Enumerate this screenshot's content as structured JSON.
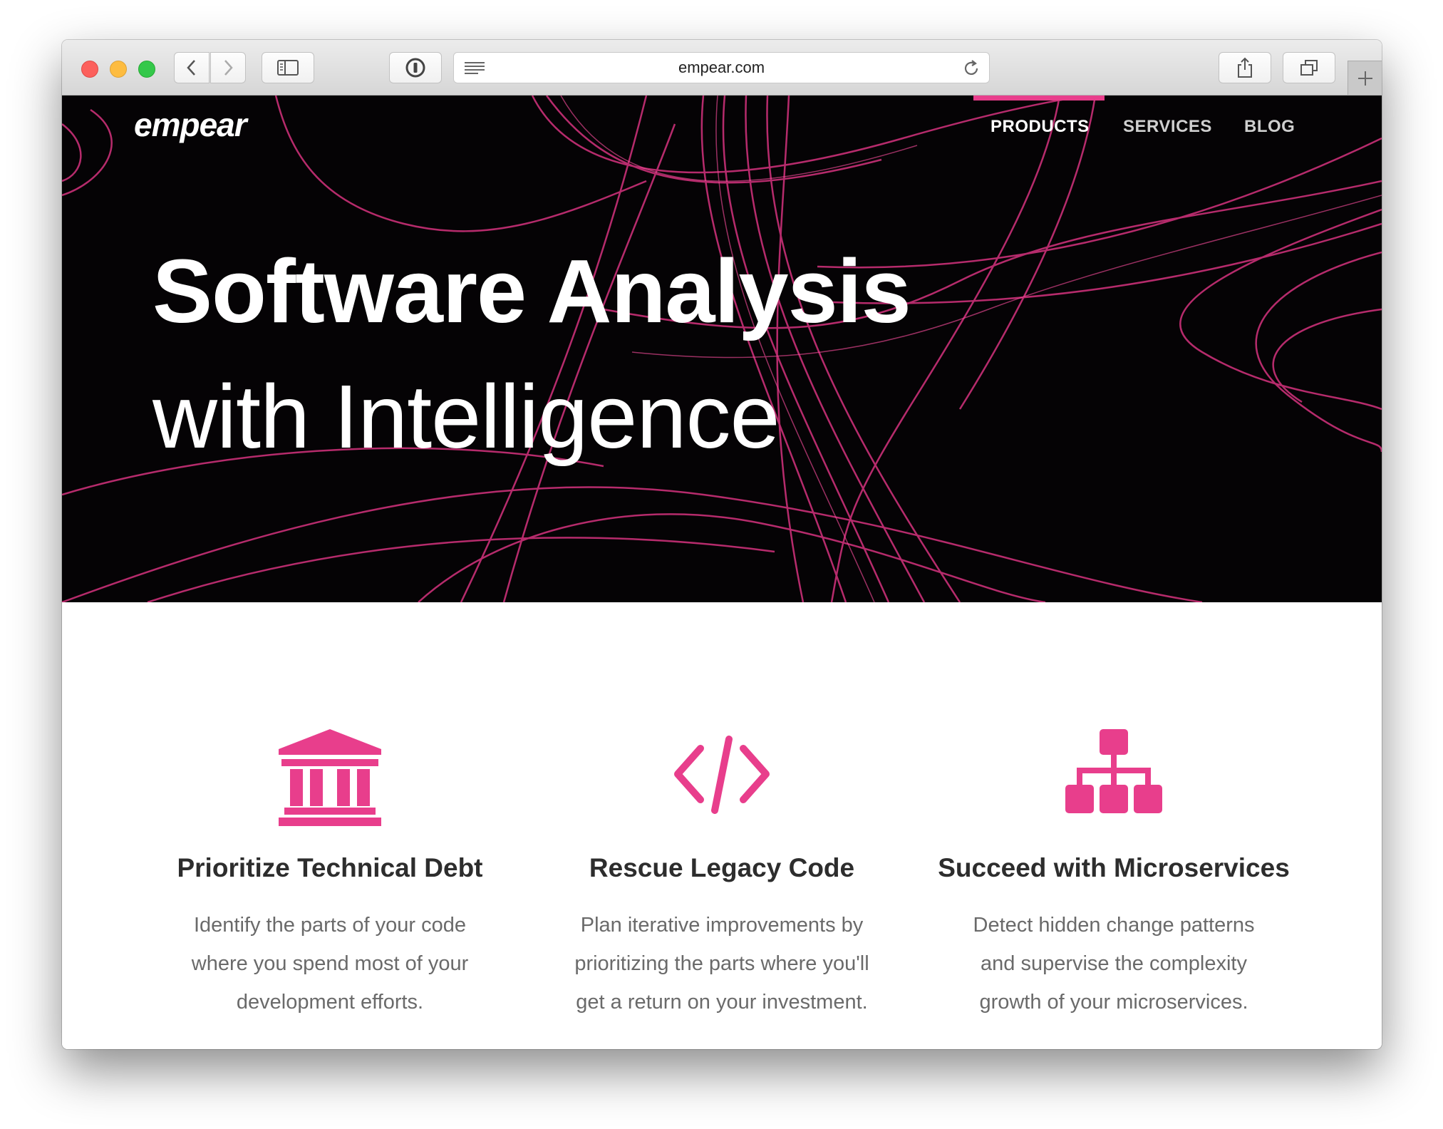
{
  "browser": {
    "url": "empear.com"
  },
  "site": {
    "logo": "empear",
    "nav": [
      {
        "label": "PRODUCTS",
        "active": true
      },
      {
        "label": "SERVICES",
        "active": false
      },
      {
        "label": "BLOG",
        "active": false
      }
    ],
    "hero": {
      "line1": "Software Analysis",
      "line2": "with Intelligence"
    },
    "features": [
      {
        "icon": "bank-icon",
        "title": "Prioritize Technical Debt",
        "description": "Identify the parts of your code where you spend most of your development efforts."
      },
      {
        "icon": "code-icon",
        "title": "Rescue Legacy Code",
        "description": "Plan iterative improvements by prioritizing the parts where you'll get a return on your investment."
      },
      {
        "icon": "sitemap-icon",
        "title": "Succeed with Microservices",
        "description": "Detect hidden change patterns and supervise the complexity growth of your microservices."
      }
    ]
  },
  "colors": {
    "accent": "#e83e8c",
    "hero_bg": "#050305"
  }
}
